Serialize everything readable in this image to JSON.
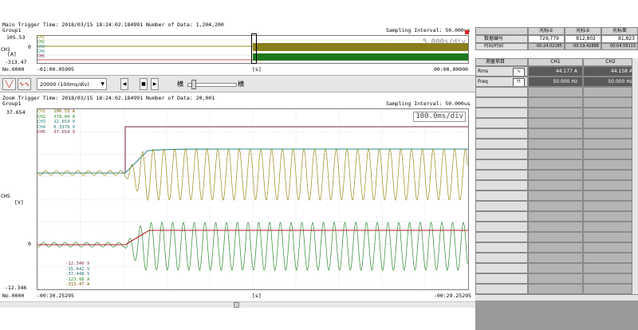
{
  "main": {
    "header_line": "Main Trigger Time: 2018/03/15 18:24:02.184991   Number of Data: 1,204,200",
    "group": "Group1",
    "sampling": "Sampling Interval:  50.000us",
    "timebase": "5.000s/div",
    "y_top": "105.53",
    "y_zero": "0",
    "y_bottom": "-313.47",
    "channel_label": "CH1",
    "unit_label": "[A]",
    "ch_tags": [
      "CH1",
      "CH2",
      "CH3",
      "CH4",
      "CH5"
    ],
    "no_label": "No.0000",
    "x_start": "-01:00.05995",
    "x_unit": "[s]",
    "x_end": "00:00.00000"
  },
  "toolbar": {
    "btn1_label": "╲╱",
    "btn2_label": "∿∿",
    "select_value": "20000  (100ms/div)",
    "play_label": "▶",
    "stop_label": "■",
    "next_label": "▶",
    "prev_label": "◀",
    "cursor_a_label": "横",
    "cursor_b_label": "横"
  },
  "zoom": {
    "header_line": "Zoom Trigger Time: 2018/03/15 18:24:02.184991   Number of Data: 20,001",
    "group": "Group1",
    "sampling": "Sampling Interval:  50.000us",
    "timebase": "100.0ms/div",
    "y_top": "37.654",
    "y_zero": "0",
    "y_bottom": "-12.346",
    "channel_label": "CH5",
    "unit_label": "[V]",
    "top_values": [
      {
        "ch": "CH1",
        "value": "106.53 A",
        "color": "#7a5a00"
      },
      {
        "ch": "CH2",
        "value": "378.04 A",
        "color": "#2e8b2e"
      },
      {
        "ch": "CH3",
        "value": "12.654 V",
        "color": "#1f6f6f"
      },
      {
        "ch": "CH4",
        "value": "6.3379 V",
        "color": "#1f6f6f"
      },
      {
        "ch": "CH5",
        "value": "37.654 V",
        "color": "#7a2a5a"
      }
    ],
    "bottom_values": [
      {
        "value": "-12.346 V",
        "color": "#7a2a5a"
      },
      {
        "value": "-15.642 V",
        "color": "#1f6f6f"
      },
      {
        "value": "-37.448 V",
        "color": "#1f6f6f"
      },
      {
        "value": "-123.98 A",
        "color": "#2e8b2e"
      },
      {
        "value": "-313.47 A",
        "color": "#7a5a00"
      }
    ],
    "no_label": "No.0000",
    "x_start": "-00:30.25295",
    "x_unit": "[s]",
    "x_end": "-00:29.25295"
  },
  "right": {
    "header_cols": [
      "光标①",
      "光标②",
      "光标差"
    ],
    "row1_label": "数据编号",
    "row1_values": [
      "729,779",
      "812,802",
      "81,823"
    ],
    "row2_label": "时间/时刻",
    "row2_values": [
      "-00:24.02185",
      "-00:19.42888",
      "00:04.59113"
    ],
    "meas_header": "测量项目",
    "meas_cols": [
      "CH1",
      "CH2"
    ],
    "meas_rows": [
      {
        "label": "Rms",
        "icon": "rms-wave-icon",
        "values": [
          "44.177 A",
          "44.158 A"
        ]
      },
      {
        "label": "Freq",
        "icon": "freq-pulse-icon",
        "values": [
          "50.000 Hz",
          "50.000 Hz"
        ]
      }
    ]
  },
  "colors": {
    "ch_olive": "#9a8c1a",
    "ch_green": "#2e8b2e",
    "ch_teal": "#2f8a8a",
    "ch_maroon": "#7a1e4a",
    "ch_red": "#b02020",
    "grid": "#c0c0c0",
    "right_dark": "#5a5a5a",
    "right_mid": "#b4b4b4"
  }
}
